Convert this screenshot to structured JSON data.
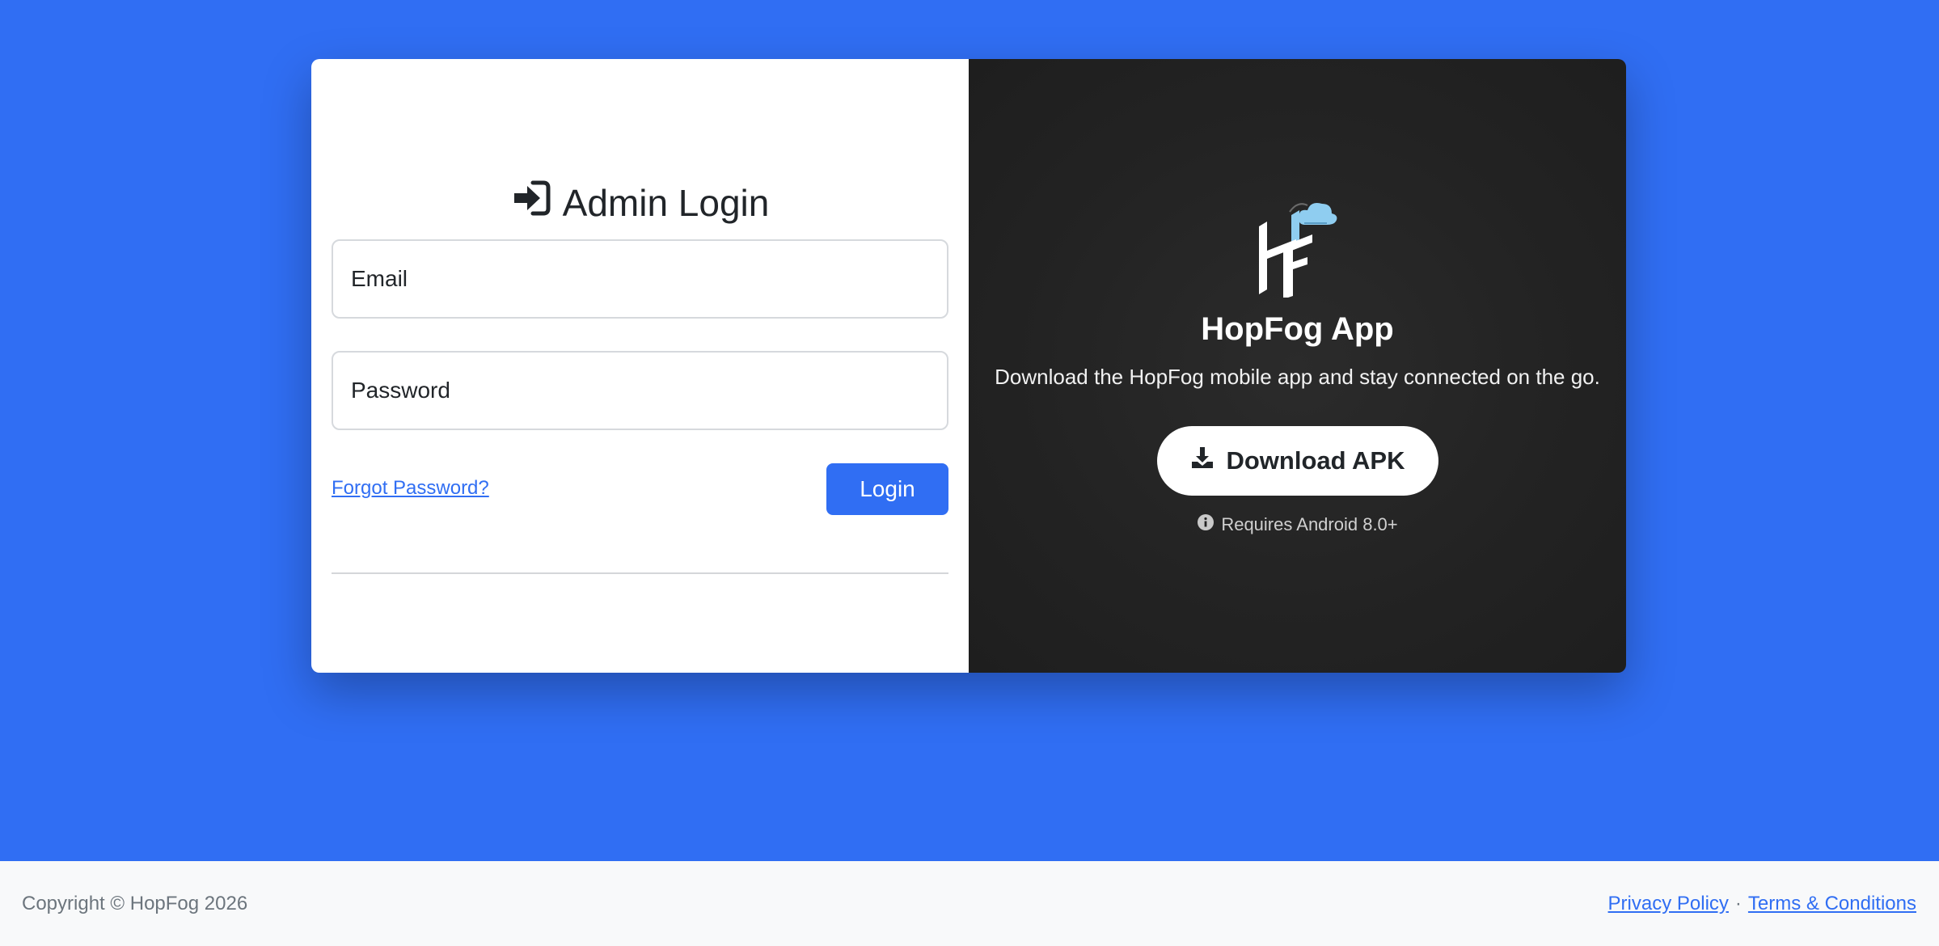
{
  "login": {
    "title": "Admin Login",
    "title_icon": "sign-in-arrow-icon",
    "email_placeholder": "Email",
    "password_placeholder": "Password",
    "forgot_label": "Forgot Password?",
    "login_label": "Login"
  },
  "app": {
    "title": "HopFog App",
    "description": "Download the HopFog mobile app and stay connected on the go.",
    "download_label": "Download APK",
    "download_icon": "download-icon",
    "requirement": "Requires Android 8.0+",
    "requirement_icon": "info-circle-icon",
    "logo_icon": "hopfog-logo-icon"
  },
  "footer": {
    "copyright": "Copyright © HopFog 2026",
    "privacy_label": "Privacy Policy",
    "separator": "·",
    "terms_label": "Terms & Conditions"
  },
  "colors": {
    "primary": "#306ef3",
    "dark_panel": "#232323",
    "footer_bg": "#f8f9fa",
    "logo_accent": "#8fcdf0"
  }
}
